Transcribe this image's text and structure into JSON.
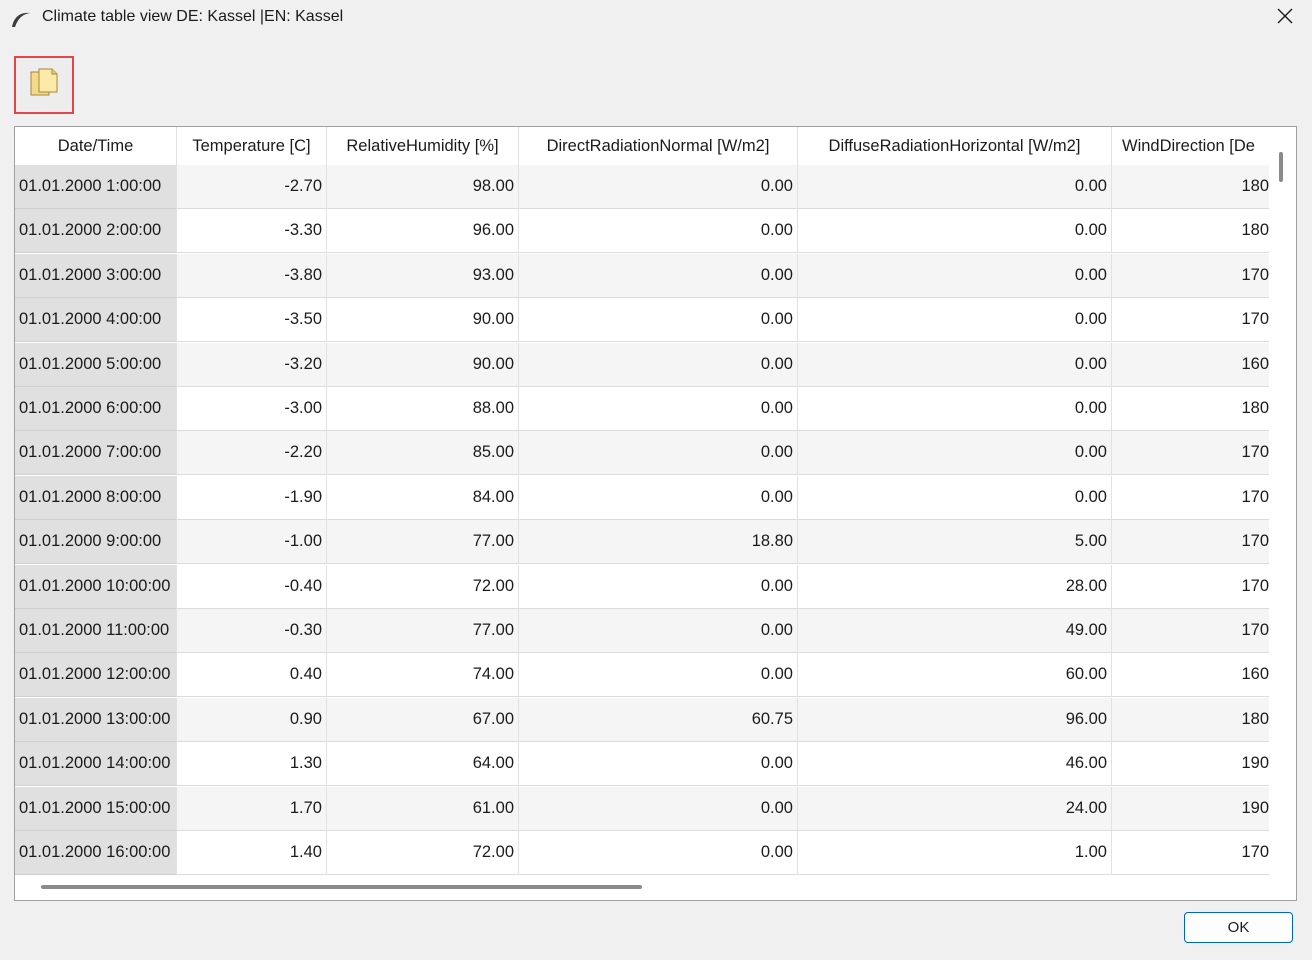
{
  "window": {
    "title": "Climate table view DE: Kassel |EN: Kassel",
    "close_icon": "close-icon",
    "app_icon": "app-icon"
  },
  "toolbar": {
    "copy_icon": "copy-icon"
  },
  "table": {
    "columns": [
      "Date/Time",
      "Temperature [C]",
      "RelativeHumidity [%]",
      "DirectRadiationNormal [W/m2]",
      "DiffuseRadiationHorizontal [W/m2]",
      "WindDirection [De"
    ],
    "rows": [
      [
        "01.01.2000  1:00:00",
        "-2.70",
        "98.00",
        "0.00",
        "0.00",
        "180"
      ],
      [
        "01.01.2000  2:00:00",
        "-3.30",
        "96.00",
        "0.00",
        "0.00",
        "180"
      ],
      [
        "01.01.2000  3:00:00",
        "-3.80",
        "93.00",
        "0.00",
        "0.00",
        "170"
      ],
      [
        "01.01.2000  4:00:00",
        "-3.50",
        "90.00",
        "0.00",
        "0.00",
        "170"
      ],
      [
        "01.01.2000  5:00:00",
        "-3.20",
        "90.00",
        "0.00",
        "0.00",
        "160"
      ],
      [
        "01.01.2000  6:00:00",
        "-3.00",
        "88.00",
        "0.00",
        "0.00",
        "180"
      ],
      [
        "01.01.2000  7:00:00",
        "-2.20",
        "85.00",
        "0.00",
        "0.00",
        "170"
      ],
      [
        "01.01.2000  8:00:00",
        "-1.90",
        "84.00",
        "0.00",
        "0.00",
        "170"
      ],
      [
        "01.01.2000  9:00:00",
        "-1.00",
        "77.00",
        "18.80",
        "5.00",
        "170"
      ],
      [
        "01.01.2000 10:00:00",
        "-0.40",
        "72.00",
        "0.00",
        "28.00",
        "170"
      ],
      [
        "01.01.2000 11:00:00",
        "-0.30",
        "77.00",
        "0.00",
        "49.00",
        "170"
      ],
      [
        "01.01.2000 12:00:00",
        "0.40",
        "74.00",
        "0.00",
        "60.00",
        "160"
      ],
      [
        "01.01.2000 13:00:00",
        "0.90",
        "67.00",
        "60.75",
        "96.00",
        "180"
      ],
      [
        "01.01.2000 14:00:00",
        "1.30",
        "64.00",
        "0.00",
        "46.00",
        "190"
      ],
      [
        "01.01.2000 15:00:00",
        "1.70",
        "61.00",
        "0.00",
        "24.00",
        "190"
      ],
      [
        "01.01.2000 16:00:00",
        "1.40",
        "72.00",
        "0.00",
        "1.00",
        "170"
      ]
    ]
  },
  "footer": {
    "ok_label": "OK"
  }
}
